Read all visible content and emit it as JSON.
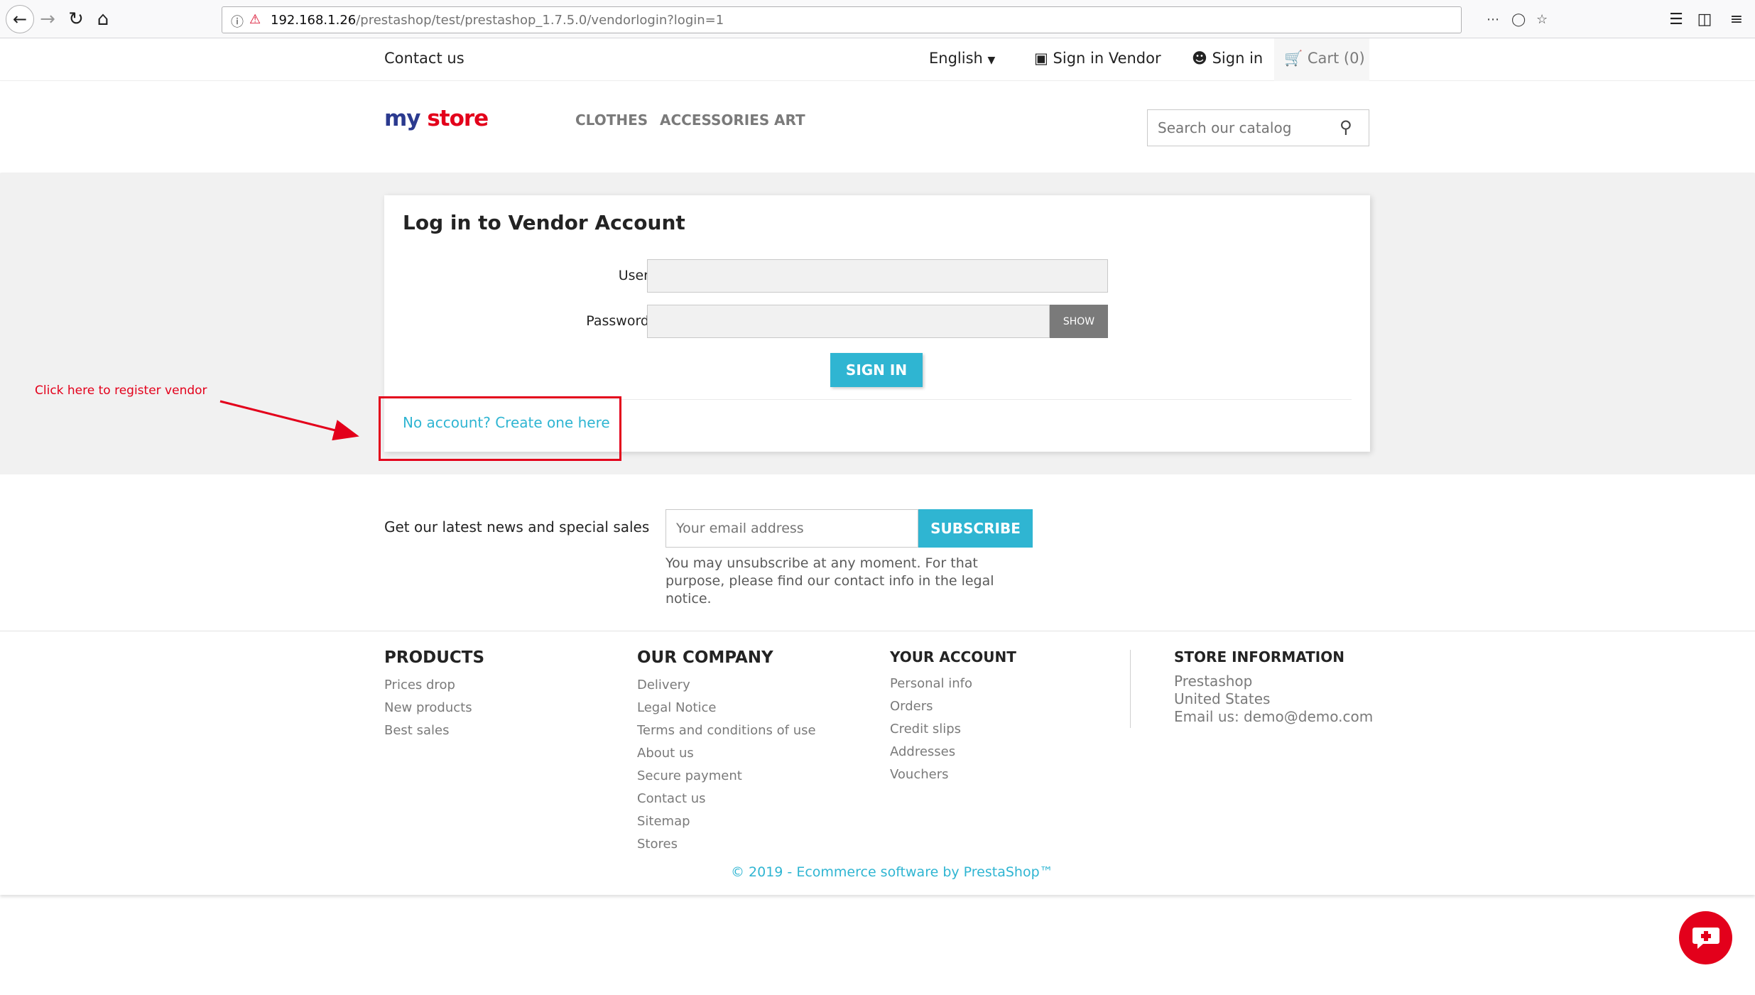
{
  "browser": {
    "url_host": "192.168.1.26",
    "url_path": "/prestashop/test/prestashop_1.7.5.0/vendorlogin?login=1"
  },
  "top_nav": {
    "contact": "Contact us",
    "language": "English",
    "sign_in_vendor": "Sign in Vendor",
    "sign_in": "Sign in",
    "cart": "Cart (0)"
  },
  "header": {
    "logo_part1": "my",
    "logo_part2": "store",
    "menu": [
      "CLOTHES",
      "ACCESSORIES",
      "ART"
    ],
    "search_placeholder": "Search our catalog"
  },
  "login": {
    "title": "Log in to Vendor Account",
    "user_label": "User",
    "password_label": "Password",
    "show_button": "SHOW",
    "signin_button": "SIGN IN",
    "create_account": "No account? Create one here"
  },
  "annotation": {
    "text": "Click here to register vendor"
  },
  "newsletter": {
    "label": "Get our latest news and special sales",
    "email_placeholder": "Your email address",
    "subscribe_button": "SUBSCRIBE",
    "note": "You may unsubscribe at any moment. For that purpose, please find our contact info in the legal notice."
  },
  "footer": {
    "products": {
      "heading": "PRODUCTS",
      "links": [
        "Prices drop",
        "New products",
        "Best sales"
      ]
    },
    "company": {
      "heading": "OUR COMPANY",
      "links": [
        "Delivery",
        "Legal Notice",
        "Terms and conditions of use",
        "About us",
        "Secure payment",
        "Contact us",
        "Sitemap",
        "Stores"
      ]
    },
    "account": {
      "heading": "YOUR ACCOUNT",
      "links": [
        "Personal info",
        "Orders",
        "Credit slips",
        "Addresses",
        "Vouchers"
      ]
    },
    "store": {
      "heading": "STORE INFORMATION",
      "lines": [
        "Prestashop",
        "United States",
        "Email us: demo@demo.com"
      ]
    },
    "copyright": "© 2019 - Ecommerce software by PrestaShop™"
  },
  "colors": {
    "accent": "#2fb5d2",
    "annotation": "#e3001b"
  }
}
